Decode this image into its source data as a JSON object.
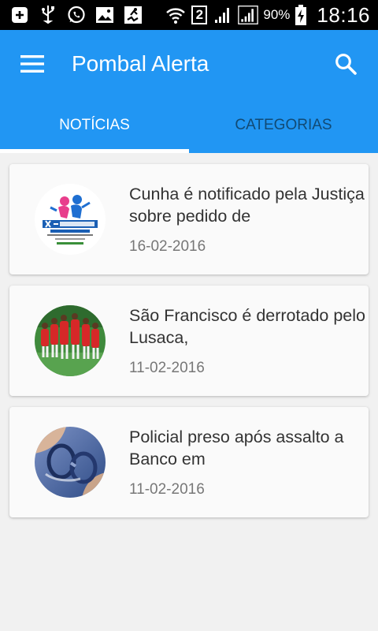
{
  "status_bar": {
    "icons": [
      "add-box-icon",
      "usb-icon",
      "whatsapp-icon",
      "image-icon",
      "running-app-icon",
      "wifi-icon",
      "sim-2-icon",
      "signal-icon",
      "signal-icon"
    ],
    "sim_label": "2",
    "battery": "90%",
    "time": "18:16"
  },
  "app_bar": {
    "title": "Pombal Alerta",
    "menu_icon": "hamburger-menu-icon",
    "search_icon": "search-icon",
    "color": "#2196f3"
  },
  "tabs": [
    {
      "label": "NOTÍCIAS",
      "active": true
    },
    {
      "label": "CATEGORIAS",
      "active": false
    }
  ],
  "news": [
    {
      "title": "Cunha é notificado pela Justiça sobre pedido de",
      "date": "16-02-2016",
      "thumb": "xsport-logo-thumb"
    },
    {
      "title": "São Francisco é derrotado pelo Lusaca,",
      "date": "11-02-2016",
      "thumb": "soccer-team-photo-thumb"
    },
    {
      "title": "Policial preso após assalto a Banco em",
      "date": "11-02-2016",
      "thumb": "handcuffs-photo-thumb"
    }
  ]
}
